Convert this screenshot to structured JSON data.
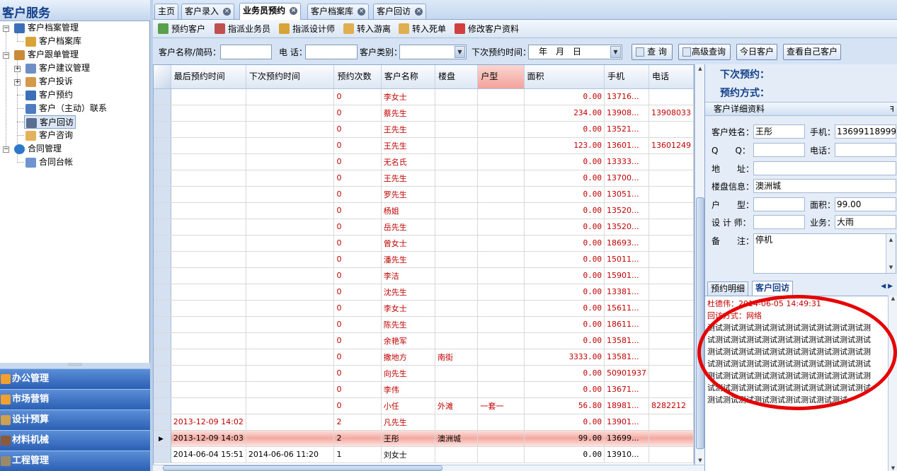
{
  "sidebar": {
    "title": "客户服务",
    "collapse_glyph": "«",
    "tree": [
      {
        "label": "客户档案管理",
        "icon": "user-icon"
      },
      {
        "label": "客户档案库",
        "icon": "database-icon"
      },
      {
        "label": "客户跟单管理",
        "icon": "folder-icon"
      },
      {
        "label": "客户建议管理",
        "icon": "suggestion-icon"
      },
      {
        "label": "客户投诉",
        "icon": "complaint-icon"
      },
      {
        "label": "客户预约",
        "icon": "user-icon"
      },
      {
        "label": "客户（主动）联系",
        "icon": "contact-icon"
      },
      {
        "label": "客户回访",
        "icon": "revisit-icon"
      },
      {
        "label": "客户咨询",
        "icon": "consult-icon"
      },
      {
        "label": "合同管理",
        "icon": "contract-icon"
      },
      {
        "label": "合同台帐",
        "icon": "ledger-icon"
      }
    ],
    "nav": [
      "办公管理",
      "市场营销",
      "设计预算",
      "材料机械",
      "工程管理"
    ]
  },
  "tabs": [
    {
      "label": "主页",
      "closable": false
    },
    {
      "label": "客户录入",
      "closable": true
    },
    {
      "label": "业务员预约",
      "closable": true,
      "active": true
    },
    {
      "label": "客户档案库",
      "closable": true
    },
    {
      "label": "客户回访",
      "closable": true
    }
  ],
  "toolbar": [
    "预约客户",
    "指派业务员",
    "指派设计师",
    "转入游离",
    "转入死单",
    "修改客户资料"
  ],
  "filter": {
    "name_label": "客户名称/简码：",
    "phone_label": "电 话：",
    "type_label": "客户类别：",
    "next_label": "下次预约时间：",
    "date_value": "年　月　日",
    "query_btn": "查 询",
    "adv_btn": "高级查询",
    "today_btn": "今日客户",
    "mine_btn": "查看自己客户"
  },
  "grid": {
    "headers": [
      "最后预约时间",
      "下次预约时间",
      "预约次数",
      "客户名称",
      "楼盘",
      "户型",
      "面积",
      "手机",
      "电话"
    ],
    "rows": [
      [
        "",
        "",
        "0",
        "李女士",
        "",
        "",
        "0.00",
        "13716...",
        ""
      ],
      [
        "",
        "",
        "0",
        "蔡先生",
        "",
        "",
        "234.00",
        "13908...",
        "13908033"
      ],
      [
        "",
        "",
        "0",
        "王先生",
        "",
        "",
        "0.00",
        "13521...",
        ""
      ],
      [
        "",
        "",
        "0",
        "王先生",
        "",
        "",
        "123.00",
        "13601...",
        "13601249"
      ],
      [
        "",
        "",
        "0",
        "无名氏",
        "",
        "",
        "0.00",
        "13333...",
        ""
      ],
      [
        "",
        "",
        "0",
        "王先生",
        "",
        "",
        "0.00",
        "13700...",
        ""
      ],
      [
        "",
        "",
        "0",
        "罗先生",
        "",
        "",
        "0.00",
        "13051...",
        ""
      ],
      [
        "",
        "",
        "0",
        "杨姐",
        "",
        "",
        "0.00",
        "13520...",
        ""
      ],
      [
        "",
        "",
        "0",
        "岳先生",
        "",
        "",
        "0.00",
        "13520...",
        ""
      ],
      [
        "",
        "",
        "0",
        "曾女士",
        "",
        "",
        "0.00",
        "18693...",
        ""
      ],
      [
        "",
        "",
        "0",
        "潘先生",
        "",
        "",
        "0.00",
        "15011...",
        ""
      ],
      [
        "",
        "",
        "0",
        "李洁",
        "",
        "",
        "0.00",
        "15901...",
        ""
      ],
      [
        "",
        "",
        "0",
        "沈先生",
        "",
        "",
        "0.00",
        "13381...",
        ""
      ],
      [
        "",
        "",
        "0",
        "李女士",
        "",
        "",
        "0.00",
        "15611...",
        ""
      ],
      [
        "",
        "",
        "0",
        "陈先生",
        "",
        "",
        "0.00",
        "18611...",
        ""
      ],
      [
        "",
        "",
        "0",
        "余艳军",
        "",
        "",
        "0.00",
        "13581...",
        ""
      ],
      [
        "",
        "",
        "0",
        "撒地方",
        "南街",
        "",
        "3333.00",
        "13581...",
        ""
      ],
      [
        "",
        "",
        "0",
        "向先生",
        "",
        "",
        "0.00",
        "50901937",
        ""
      ],
      [
        "",
        "",
        "0",
        "李伟",
        "",
        "",
        "0.00",
        "13671...",
        ""
      ],
      [
        "",
        "",
        "0",
        "小任",
        "外滩",
        "一套一",
        "56.80",
        "18981...",
        "8282212"
      ],
      [
        "2013-12-09 14:02",
        "",
        "2",
        "凡先生",
        "",
        "",
        "0.00",
        "13901...",
        ""
      ],
      [
        "2013-12-09 14:03",
        "",
        "2",
        "王彤",
        "澳洲城",
        "",
        "99.00",
        "13699...",
        ""
      ],
      [
        "2014-06-04 15:51",
        "2014-06-06 11:20",
        "1",
        "刘女士",
        "",
        "",
        "0.00",
        "13910...",
        ""
      ]
    ],
    "current_row": 21,
    "black_rows": [
      21,
      22
    ],
    "current_marker": "▶"
  },
  "right": {
    "next_label": "下次预约：",
    "method_label": "预约方式：",
    "detail_title": "客户详细资料",
    "pin_glyph": "ꟻ",
    "fields": {
      "name_label": "客户姓名：",
      "name": "王彤",
      "mobile_label": "手机：",
      "mobile": "13699118999",
      "qq_label": "Q　　Q：",
      "qq": "",
      "tel_label": "电话：",
      "tel": "",
      "addr_label": "地　　址：",
      "addr": "",
      "estate_label": "楼盘信息：",
      "estate": "澳洲城",
      "type_label": "户　　型：",
      "type": "",
      "area_label": "面积：",
      "area": "99.00",
      "designer_label": "设 计 师：",
      "designer": "",
      "biz_label": "业务：",
      "biz": "大雨",
      "note_label": "备　　注：",
      "note": "停机"
    },
    "subtabs": [
      "预约明细",
      "客户回访"
    ],
    "visit": {
      "meta1": "杜德伟：2014-06-05 14:49:31",
      "meta2": "回访方式：网络",
      "body": "测试测试测试测试测试测试测试测试测试测试测试测试测试测试测试测试测试测试测试测试测试测试测试测试测试测试测试测试测试测试测试测试测试测试测试测试测试测试测试测试测试测试测试测试测试测试测试测试测试测试测试测试测试测试测试测试测试测试测试测试测试测试测试测试测试测试测试测试测试测试测试测试"
    },
    "annotation_color": "#e60000"
  }
}
